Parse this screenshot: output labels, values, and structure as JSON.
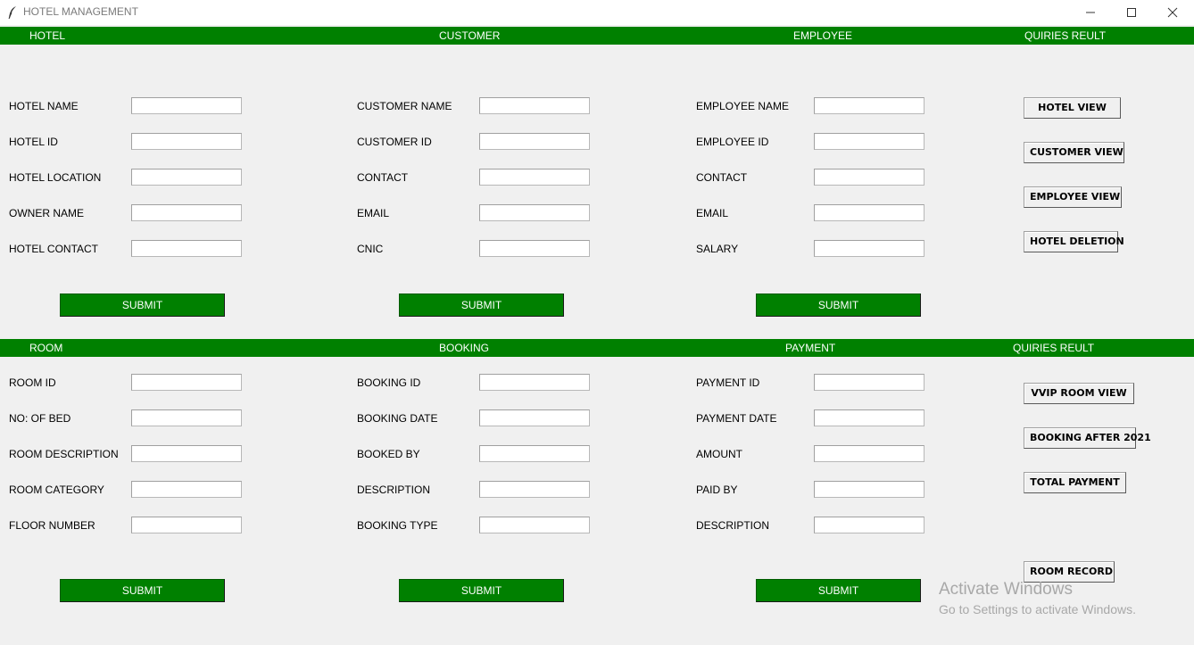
{
  "window": {
    "title": "HOTEL MANAGEMENT"
  },
  "top_bar": {
    "hotel": "HOTEL",
    "customer": "CUSTOMER",
    "employee": "EMPLOYEE",
    "queries": "QUIRIES REULT"
  },
  "bottom_bar": {
    "room": "ROOM",
    "booking": "BOOKING",
    "payment": "PAYMENT",
    "queries": "QUIRIES REULT"
  },
  "hotel": {
    "fields": [
      "HOTEL NAME",
      "HOTEL ID",
      "HOTEL LOCATION",
      "OWNER NAME",
      "HOTEL CONTACT"
    ],
    "submit": "SUBMIT"
  },
  "customer": {
    "fields": [
      "CUSTOMER NAME",
      "CUSTOMER ID",
      "CONTACT",
      "EMAIL",
      "CNIC"
    ],
    "submit": "SUBMIT"
  },
  "employee": {
    "fields": [
      "EMPLOYEE NAME",
      "EMPLOYEE ID",
      "CONTACT",
      "EMAIL",
      "SALARY"
    ],
    "submit": "SUBMIT"
  },
  "room": {
    "fields": [
      "ROOM ID",
      "NO: OF BED",
      "ROOM DESCRIPTION",
      "ROOM CATEGORY",
      "FLOOR NUMBER"
    ],
    "submit": "SUBMIT"
  },
  "booking": {
    "fields": [
      "BOOKING ID",
      "BOOKING DATE",
      "BOOKED BY",
      "DESCRIPTION",
      "BOOKING TYPE"
    ],
    "submit": "SUBMIT"
  },
  "payment": {
    "fields": [
      "PAYMENT ID",
      "PAYMENT DATE",
      "AMOUNT",
      "PAID BY",
      "DESCRIPTION"
    ],
    "submit": "SUBMIT"
  },
  "queries_top": {
    "hotel_view": "HOTEL VIEW",
    "customer_view": "CUSTOMER VIEW",
    "employee_view": "EMPLOYEE VIEW",
    "hotel_deletion": "HOTEL DELETION"
  },
  "queries_bottom": {
    "vvip_room_view": "VVIP ROOM VIEW",
    "booking_after_2021": "BOOKING AFTER 2021",
    "total_payment": "TOTAL PAYMENT",
    "room_record": "ROOM RECORD"
  },
  "watermark": {
    "line1": "Activate Windows",
    "line2": "Go to Settings to activate Windows."
  },
  "colors": {
    "header_green": "#008000",
    "submit_green": "#008000",
    "background": "#f0f0f0"
  },
  "icons": {
    "app": "feather-icon",
    "minimize": "minimize-icon",
    "maximize": "maximize-icon",
    "close": "close-icon"
  }
}
